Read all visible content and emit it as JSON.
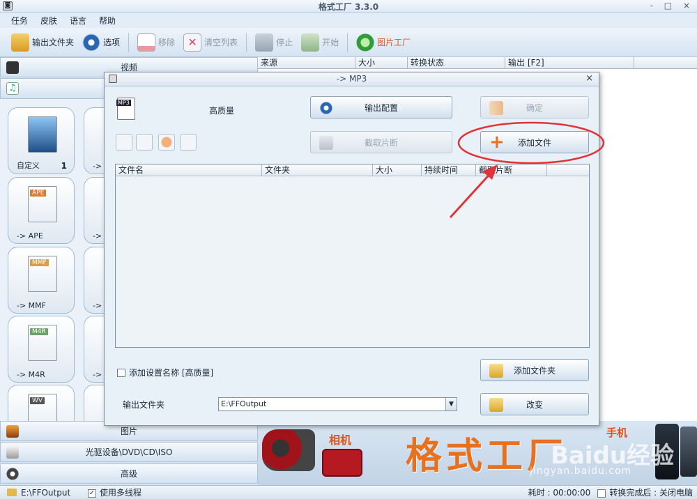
{
  "window": {
    "title": "格式工厂 3.3.0",
    "controls": "- □ ×"
  },
  "menu": [
    "任务",
    "皮肤",
    "语言",
    "帮助"
  ],
  "toolbar": {
    "output_folder": "输出文件夹",
    "options": "选项",
    "remove": "移除",
    "clear_list": "清空列表",
    "stop": "停止",
    "start": "开始",
    "picture_factory": "图片工厂"
  },
  "categories": {
    "video": "视频",
    "picture": "图片",
    "rom": "光驱设备\\DVD\\CD\\ISO",
    "advanced": "高级"
  },
  "tiles": [
    {
      "label": "自定义",
      "count": "1",
      "tag": ""
    },
    {
      "label": "-> APE",
      "count": "",
      "tag": "APE"
    },
    {
      "label": "-> MMF",
      "count": "",
      "tag": "MMF"
    },
    {
      "label": "-> M4R",
      "count": "",
      "tag": "M4R"
    },
    {
      "label": "",
      "count": "",
      "tag": "WV"
    }
  ],
  "tiles_right_fragment": "->",
  "task_columns": [
    "来源",
    "大小",
    "转换状态",
    "输出 [F2]"
  ],
  "banner": {
    "camera_label": "相机",
    "brand": "格式工厂",
    "phone_label": "手机",
    "watermark": "Baidu经验",
    "watermark_url": "jingyan.baidu.com"
  },
  "statusbar": {
    "path": "E:\\FFOutput",
    "multithread": "使用多线程",
    "elapsed": "耗时 : 00:00:00",
    "after": "转换完成后 : 关闭电脑"
  },
  "dialog": {
    "title": "-> MP3",
    "icon_tag": "MP3",
    "quality": "高质量",
    "output_config": "输出配置",
    "confirm": "确定",
    "clip": "截取片断",
    "add_file": "添加文件",
    "columns": [
      "文件名",
      "文件夹",
      "大小",
      "持续时间",
      "截取片断"
    ],
    "add_setting_name": "添加设置名称 [高质量]",
    "add_folder": "添加文件夹",
    "output_folder_label": "输出文件夹",
    "output_folder_value": "E:\\FFOutput",
    "change": "改变"
  },
  "colors": {
    "annotation": "#e0343a",
    "accent": "#e8711f"
  }
}
